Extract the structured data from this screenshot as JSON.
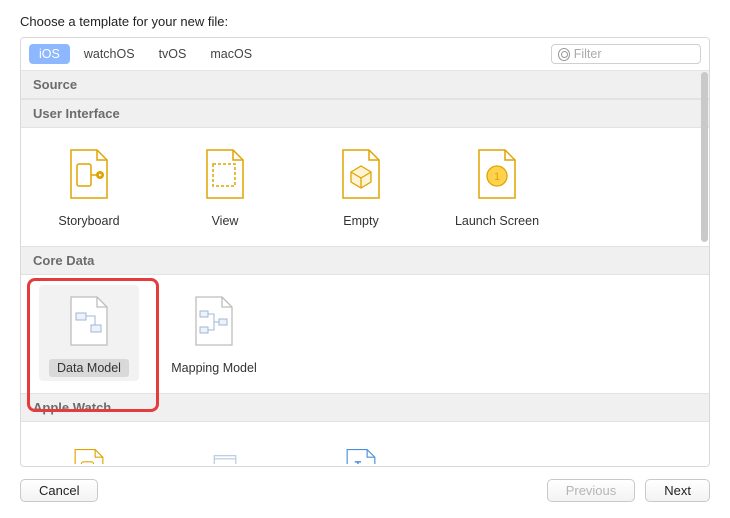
{
  "prompt": "Choose a template for your new file:",
  "tabs": [
    {
      "label": "iOS",
      "selected": true
    },
    {
      "label": "watchOS",
      "selected": false
    },
    {
      "label": "tvOS",
      "selected": false
    },
    {
      "label": "macOS",
      "selected": false
    }
  ],
  "filter": {
    "placeholder": "Filter"
  },
  "sections": [
    {
      "title": "Source"
    },
    {
      "title": "User Interface",
      "items": [
        {
          "label": "Storyboard"
        },
        {
          "label": "View"
        },
        {
          "label": "Empty"
        },
        {
          "label": "Launch Screen"
        }
      ]
    },
    {
      "title": "Core Data",
      "items": [
        {
          "label": "Data Model",
          "selected": true
        },
        {
          "label": "Mapping Model"
        }
      ]
    },
    {
      "title": "Apple Watch"
    }
  ],
  "buttons": {
    "cancel": "Cancel",
    "previous": "Previous",
    "next": "Next"
  }
}
